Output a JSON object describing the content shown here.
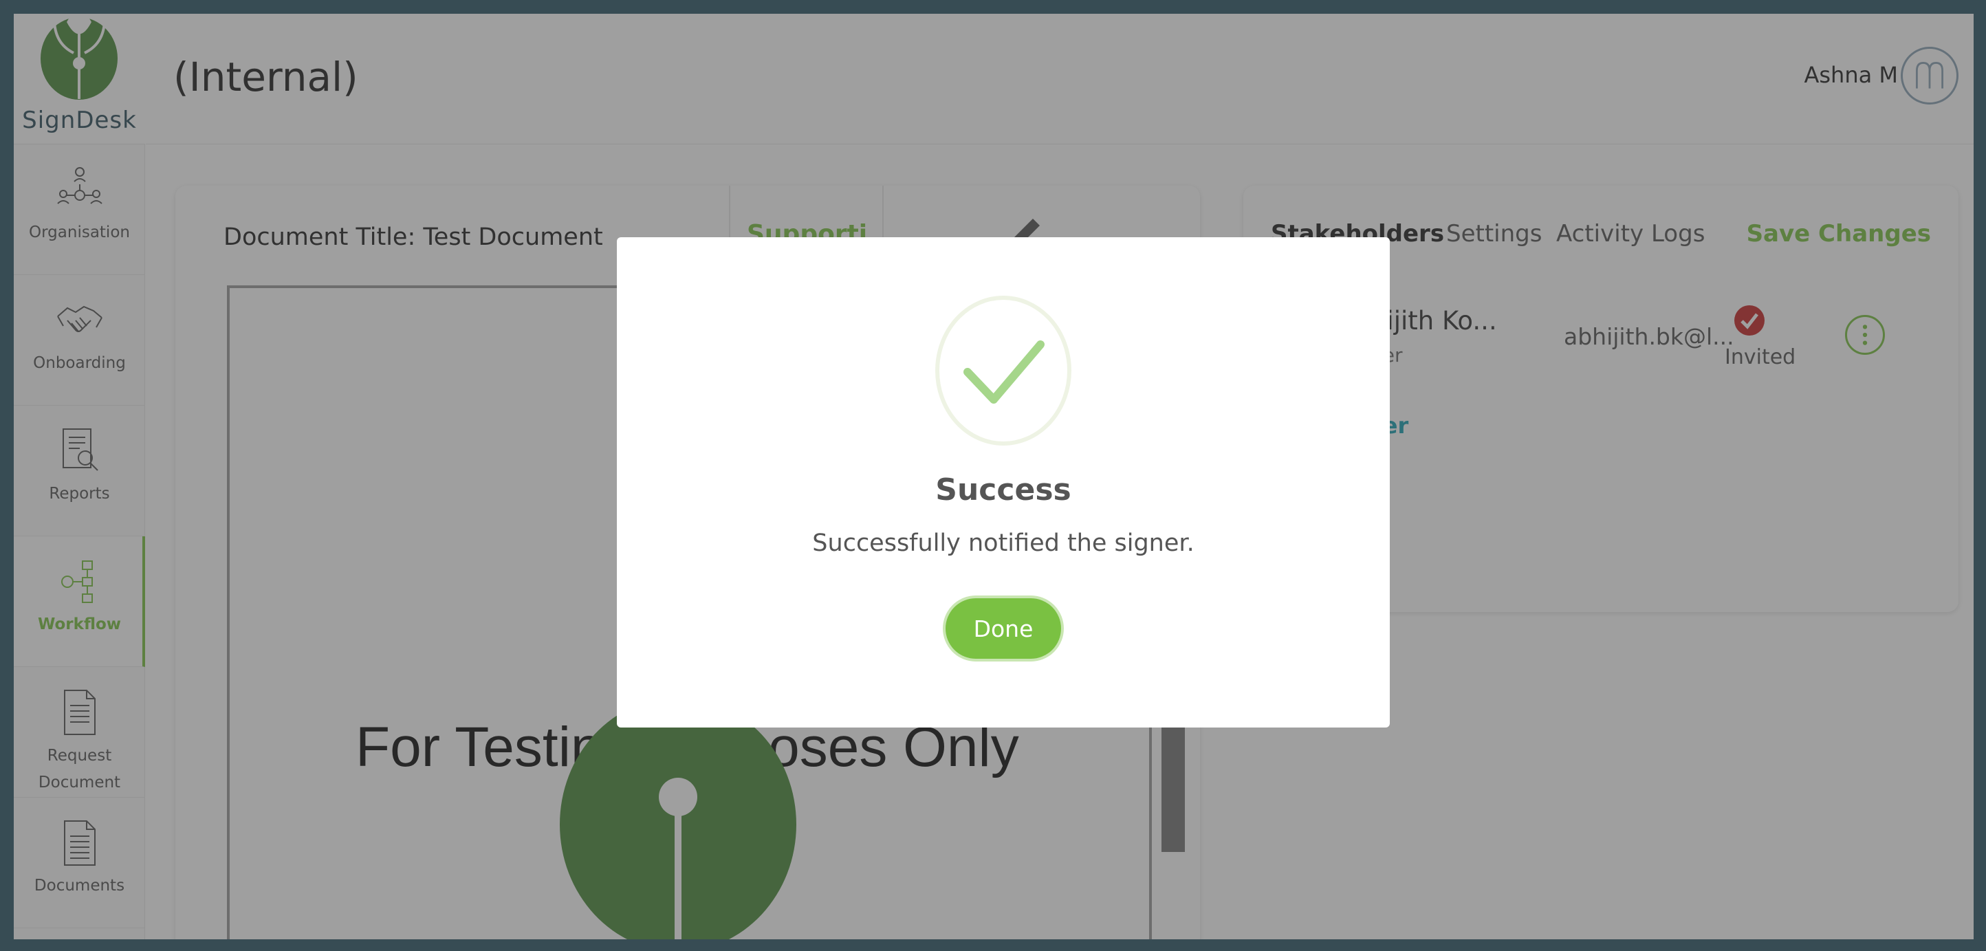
{
  "app": {
    "logo_text": "SignDesk",
    "page_title": "(Internal)",
    "user_name": "Ashna M"
  },
  "sidebar": {
    "items": [
      {
        "label": "Organisation",
        "icon": "organisation-icon"
      },
      {
        "label": "Onboarding",
        "icon": "handshake-icon"
      },
      {
        "label": "Reports",
        "icon": "report-search-icon"
      },
      {
        "label": "Workflow",
        "icon": "workflow-icon",
        "active": true
      },
      {
        "label": "Request\nDocument",
        "icon": "request-document-icon"
      },
      {
        "label": "Documents",
        "icon": "documents-icon"
      }
    ]
  },
  "document": {
    "title": "Document Title: Test Document",
    "supporting_tab": "Supporti...",
    "watermark_text": "For Testing Purposes Only"
  },
  "panel": {
    "tabs": [
      "Stakeholders",
      "Settings",
      "Activity Logs"
    ],
    "save_label": "Save Changes",
    "signer": {
      "name": "hijith Ko...",
      "role": "ner",
      "email": "abhijith.bk@l...",
      "status": "Invited"
    },
    "add_signer_label": "ner"
  },
  "modal": {
    "title": "Success",
    "message": "Successfully notified the signer.",
    "button_label": "Done"
  },
  "colors": {
    "accent": "#7ac142",
    "frame": "#2f5868",
    "status_invited": "#c62828",
    "link": "#1aa0b3"
  }
}
